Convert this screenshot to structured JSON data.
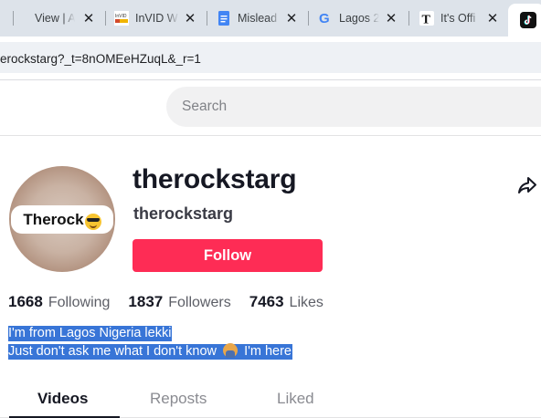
{
  "browser": {
    "tabs": [
      {
        "label": "View | A",
        "icon": "page-icon"
      },
      {
        "label": "InVID W",
        "icon": "invid-icon",
        "icon_text": "InVID"
      },
      {
        "label": "Mislead",
        "icon": "docs-icon"
      },
      {
        "label": "Lagos 2",
        "icon": "google-icon",
        "icon_text": "G"
      },
      {
        "label": "It's Offi",
        "icon": "telegraph-icon",
        "icon_text": "T"
      },
      {
        "label": "",
        "icon": "tiktok-icon",
        "active": true
      }
    ],
    "close_glyph": "✕",
    "url": "erockstarg?_t=8nOMEeHZuqL&_r=1"
  },
  "header": {
    "search_placeholder": "Search"
  },
  "profile": {
    "avatar_text": "Therock",
    "username": "therockstarg",
    "nickname": "therockstarg",
    "follow_label": "Follow",
    "stats": {
      "following_count": "1668",
      "following_label": "Following",
      "followers_count": "1837",
      "followers_label": "Followers",
      "likes_count": "7463",
      "likes_label": "Likes"
    },
    "bio_line1": "I'm from Lagos Nigeria lekki",
    "bio_line2_a": "Just don't ask me what I don't know",
    "bio_line2_b": "I'm here"
  },
  "profile_tabs": [
    {
      "label": "Videos",
      "active": true
    },
    {
      "label": "Reposts",
      "active": false
    },
    {
      "label": "Liked",
      "active": false
    }
  ],
  "colors": {
    "follow": "#fe2c55",
    "selection": "#3875d7",
    "tabstrip": "#dde3ea"
  }
}
